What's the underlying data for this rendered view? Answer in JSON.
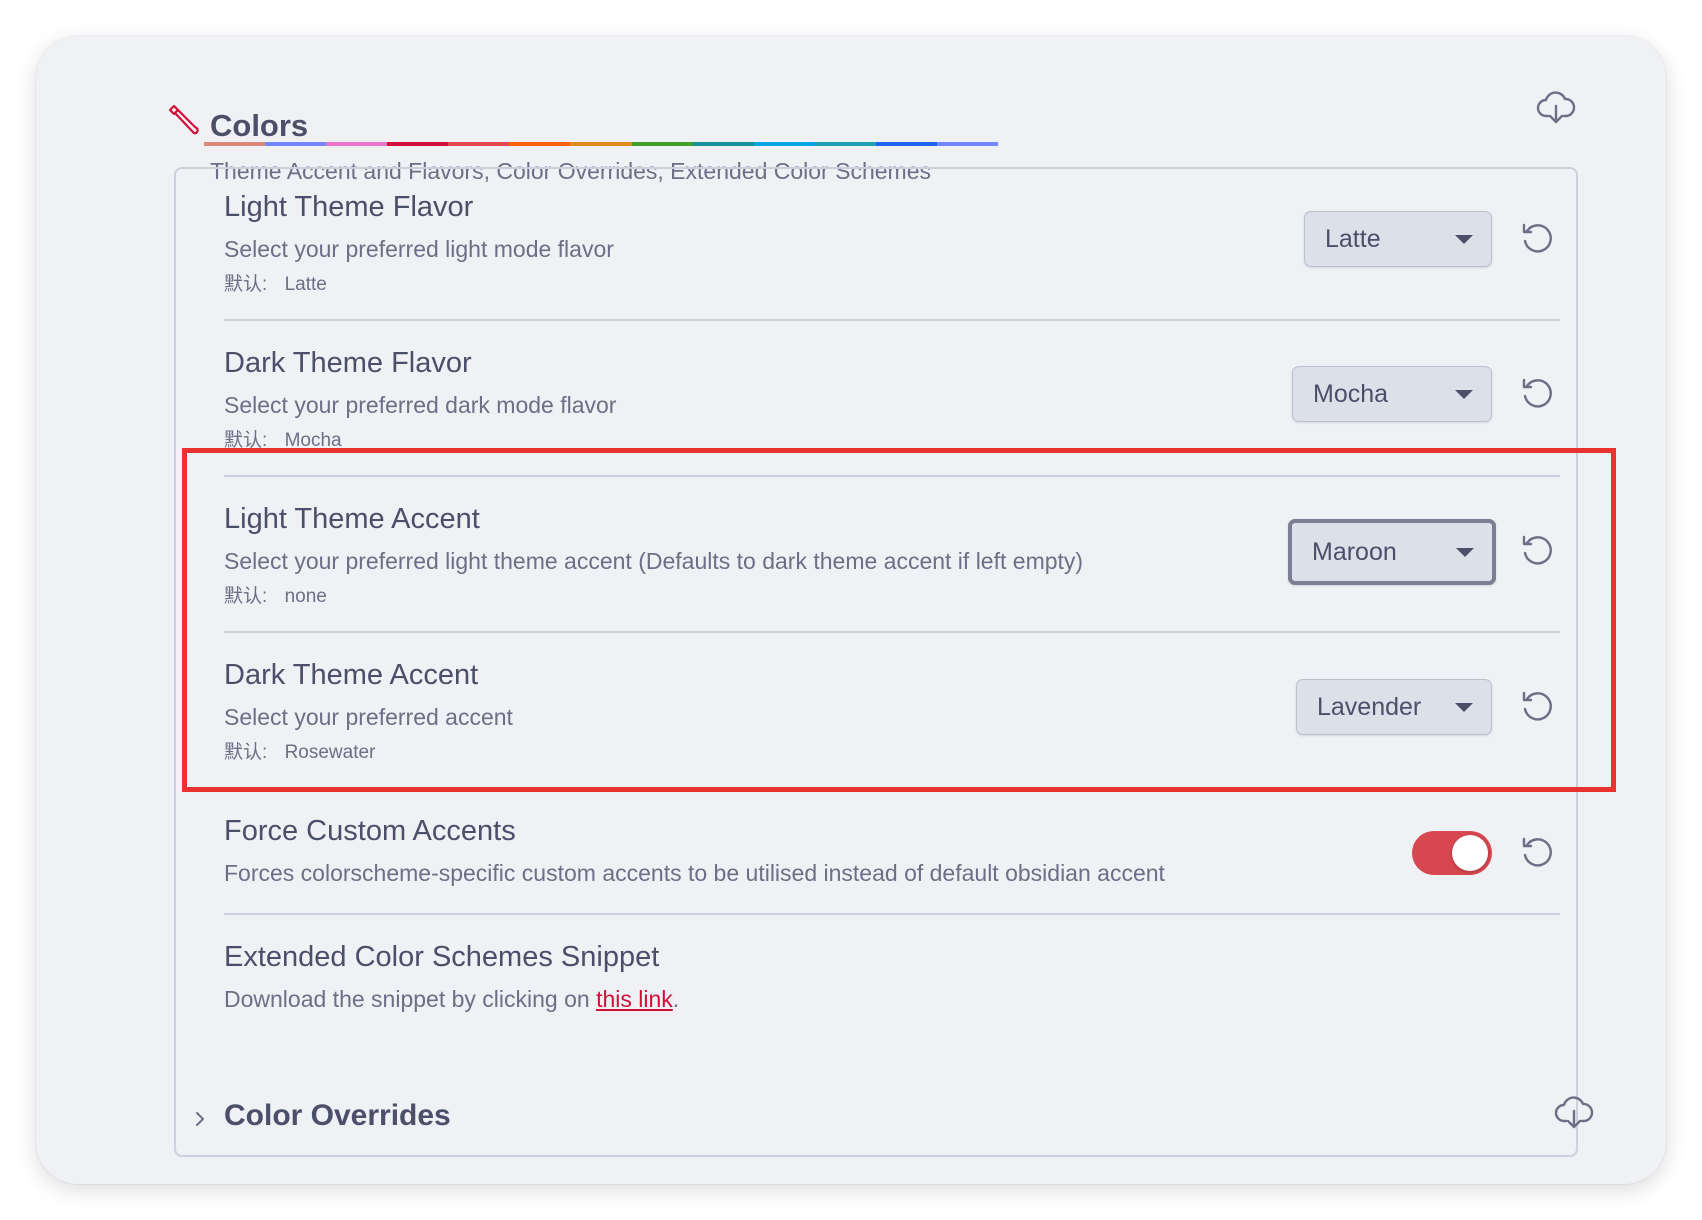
{
  "section": {
    "title": "Colors",
    "subtitle": "Theme Accent and Flavors, Color Overrides, Extended Color Schemes",
    "rainbow_colors": [
      "#dc8a78",
      "#7287fd",
      "#ea76cb",
      "#d20f39",
      "#e64553",
      "#fe640b",
      "#df8e1d",
      "#40a02b",
      "#179299",
      "#04a5e5",
      "#209fb5",
      "#1e66f5",
      "#7287fd"
    ]
  },
  "rows": {
    "light_flavor": {
      "title": "Light Theme Flavor",
      "desc": "Select your preferred light mode flavor",
      "default_label": "默认:",
      "default_value": "Latte",
      "selected": "Latte"
    },
    "dark_flavor": {
      "title": "Dark Theme Flavor",
      "desc": "Select your preferred dark mode flavor",
      "default_label": "默认:",
      "default_value": "Mocha",
      "selected": "Mocha"
    },
    "light_accent": {
      "title": "Light Theme Accent",
      "desc": "Select your preferred light theme accent (Defaults to dark theme accent if left empty)",
      "default_label": "默认:",
      "default_value": "none",
      "selected": "Maroon"
    },
    "dark_accent": {
      "title": "Dark Theme Accent",
      "desc": "Select your preferred accent",
      "default_label": "默认:",
      "default_value": "Rosewater",
      "selected": "Lavender"
    },
    "force_accents": {
      "title": "Force Custom Accents",
      "desc": "Forces colorscheme-specific custom accents to be utilised instead of default obsidian accent",
      "toggle_on": true
    },
    "extended": {
      "title": "Extended Color Schemes Snippet",
      "desc_prefix": "Download the snippet by clicking on ",
      "link_text": "this link",
      "desc_suffix": "."
    }
  },
  "collapsible": {
    "title": "Color Overrides"
  },
  "colors": {
    "accent_red": "#d6474f",
    "highlight": "#e8332e",
    "text": "#4c4f69",
    "muted": "#6c6f85"
  }
}
